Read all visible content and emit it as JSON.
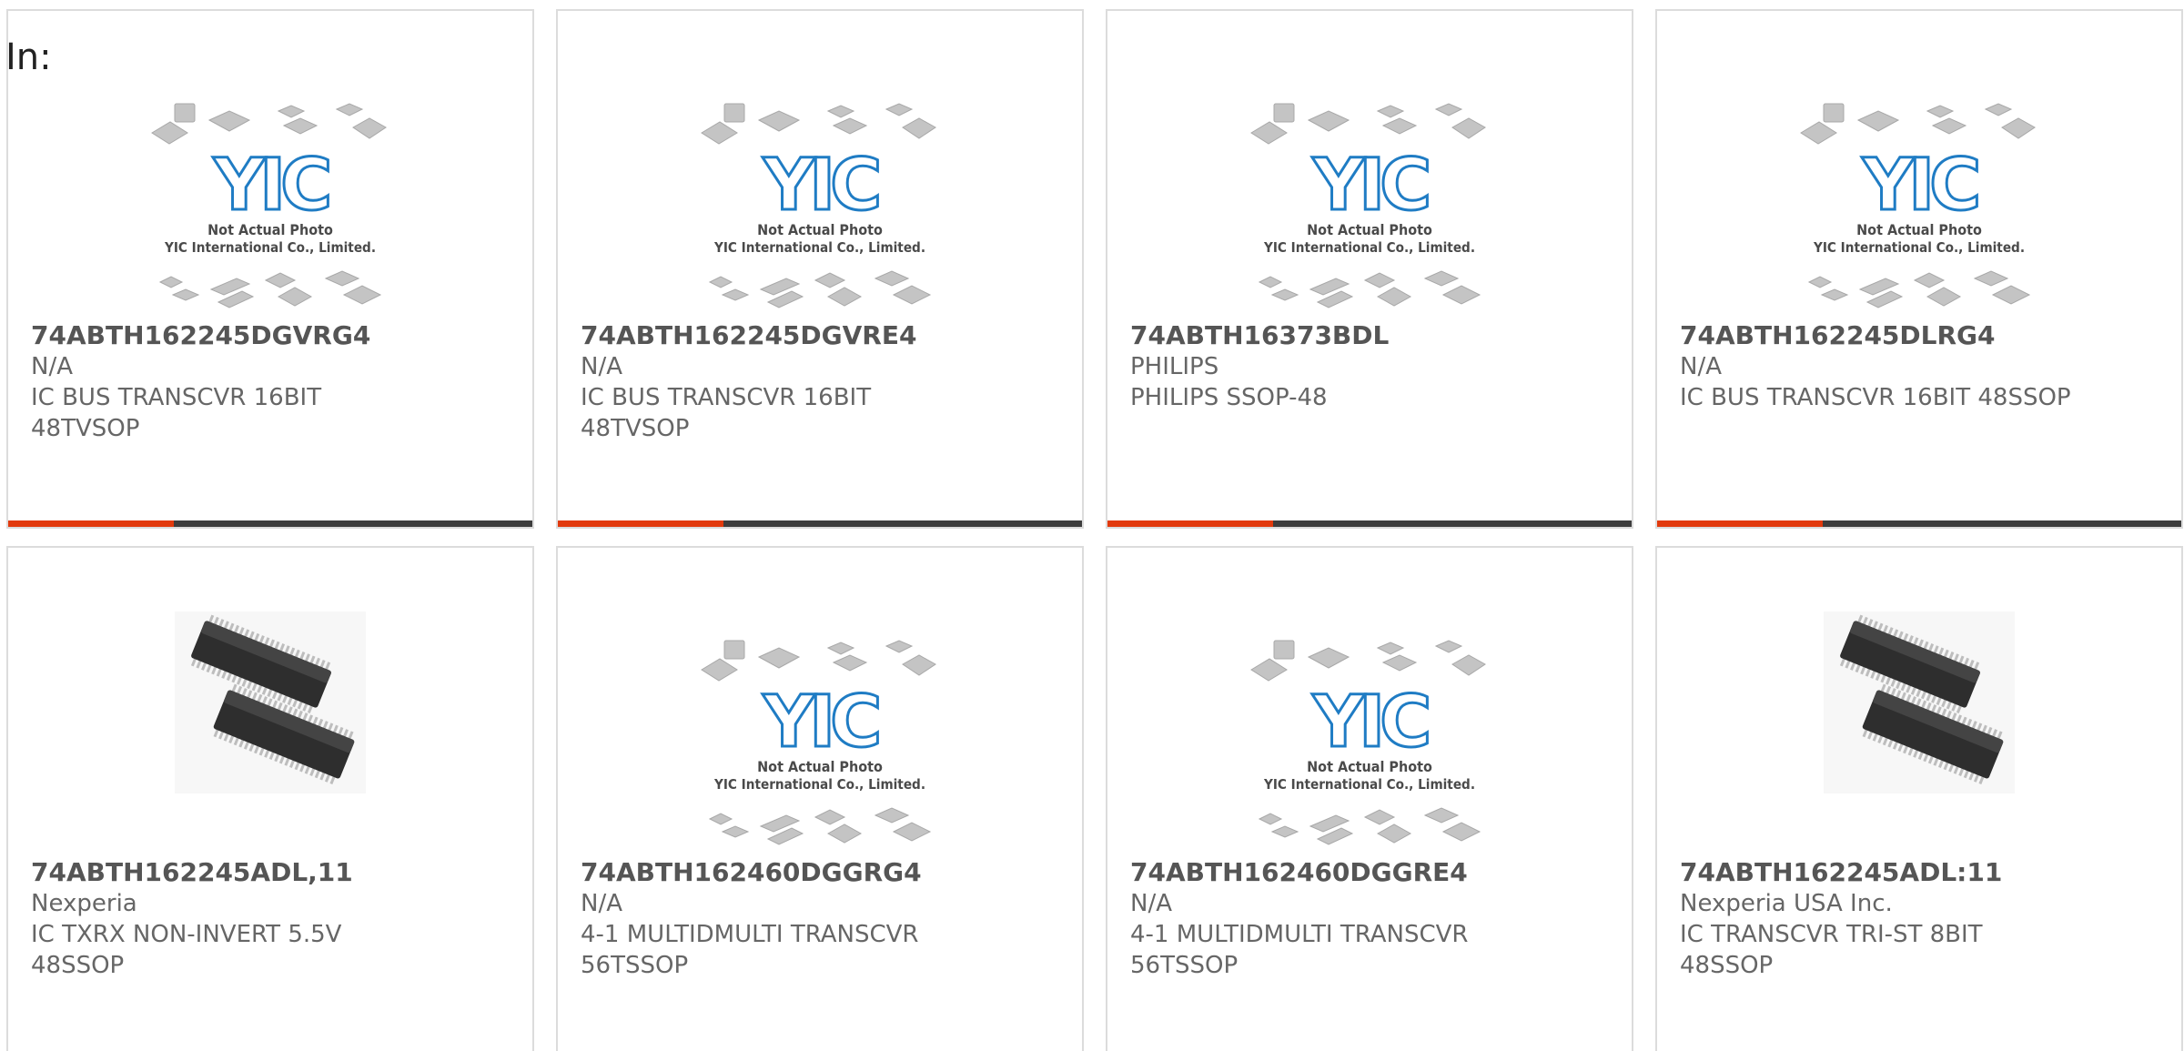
{
  "prefix_label": "In:",
  "placeholder": {
    "logo_text": "YIC",
    "line1": "Not Actual Photo",
    "line2": "YIC International Co., Limited."
  },
  "colors": {
    "accent": "#e23a0d",
    "bar": "#3d3d3d",
    "border": "#dcdcdc",
    "logo_blue": "#1f7cc4"
  },
  "products": [
    {
      "part": "74ABTH162245DGVRG4",
      "maker": "N/A",
      "desc": "IC BUS TRANSCVR 16BIT",
      "desc2": "48TVSOP",
      "image": "placeholder"
    },
    {
      "part": "74ABTH162245DGVRE4",
      "maker": "N/A",
      "desc": "IC BUS TRANSCVR 16BIT",
      "desc2": "48TVSOP",
      "image": "placeholder"
    },
    {
      "part": "74ABTH16373BDL",
      "maker": "PHILIPS",
      "desc": "PHILIPS SSOP-48",
      "desc2": "",
      "image": "placeholder"
    },
    {
      "part": "74ABTH162245DLRG4",
      "maker": "N/A",
      "desc": "IC BUS TRANSCVR 16BIT 48SSOP",
      "desc2": "",
      "image": "placeholder"
    },
    {
      "part": "74ABTH162245ADL,11",
      "maker": "Nexperia",
      "desc": "IC TXRX NON-INVERT 5.5V",
      "desc2": "48SSOP",
      "image": "chip-photo"
    },
    {
      "part": "74ABTH162460DGGRG4",
      "maker": "N/A",
      "desc": "4-1 MULTIDMULTI TRANSCVR",
      "desc2": "56TSSOP",
      "image": "placeholder"
    },
    {
      "part": "74ABTH162460DGGRE4",
      "maker": "N/A",
      "desc": "4-1 MULTIDMULTI TRANSCVR",
      "desc2": "56TSSOP",
      "image": "placeholder"
    },
    {
      "part": "74ABTH162245ADL:11",
      "maker": "Nexperia USA Inc.",
      "desc": "IC TRANSCVR TRI-ST 8BIT",
      "desc2": "48SSOP",
      "image": "chip-photo"
    }
  ]
}
